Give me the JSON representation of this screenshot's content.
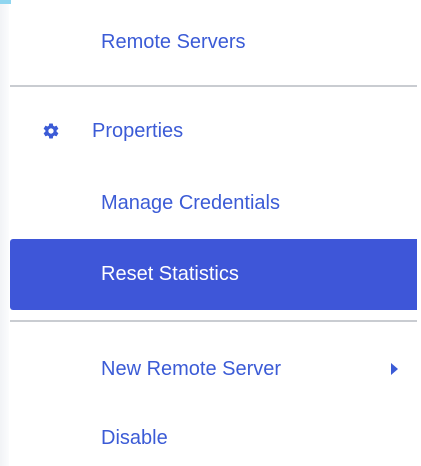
{
  "menu": {
    "items": [
      {
        "label": "Remote Servers"
      },
      {
        "label": "Properties",
        "icon": "gear-icon"
      },
      {
        "label": "Manage Credentials"
      },
      {
        "label": "Reset Statistics",
        "selected": true
      },
      {
        "label": "New Remote Server",
        "submenu": true,
        "icon": "chevron-right-icon"
      },
      {
        "label": "Disable"
      }
    ]
  },
  "colors": {
    "accent": "#3e56d8",
    "text": "#3b5bd6",
    "divider": "#c9ccd1",
    "background": "#ffffff"
  }
}
